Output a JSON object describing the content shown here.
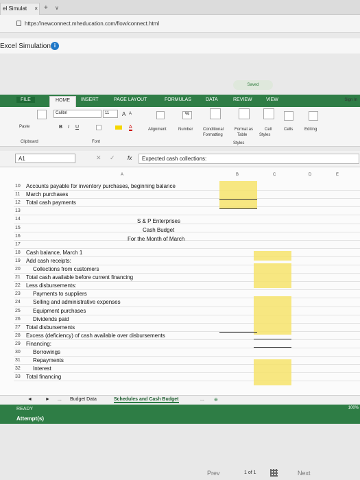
{
  "browser": {
    "tab_title": "el Simulat",
    "tab_close": "×",
    "new_tab": "+",
    "tab_menu": "∨",
    "url": "https://newconnect.mheducation.com/flow/connect.html"
  },
  "app": {
    "title": "Excel Simulation",
    "saved_label": "Saved"
  },
  "ribbon_tabs": [
    "FILE",
    "HOME",
    "INSERT",
    "PAGE LAYOUT",
    "FORMULAS",
    "DATA",
    "REVIEW",
    "VIEW"
  ],
  "sign_in": "Sign In",
  "ribbon": {
    "paste": "Paste",
    "font_name": "Calibri",
    "font_size": "11",
    "grow_font": "A",
    "shrink_font": "A",
    "bold": "B",
    "italic": "I",
    "underline": "U",
    "alignment": "Alignment",
    "number": "Number",
    "percent": "%",
    "conditional": "Conditional",
    "formatting": "Formatting",
    "format_as": "Format as",
    "table": "Table",
    "cell": "Cell",
    "styles_btn": "Styles",
    "cells": "Cells",
    "editing": "Editing",
    "clipboard": "Clipboard",
    "font_group": "Font",
    "styles_group": "Styles"
  },
  "formula_bar": {
    "name_box": "A1",
    "fx": "fx",
    "content": "Expected cash collections:"
  },
  "columns": [
    "A",
    "B",
    "C",
    "D",
    "E"
  ],
  "rows": [
    {
      "n": "10",
      "text": "Accounts payable for inventory purchases, beginning balance"
    },
    {
      "n": "11",
      "text": "March purchases"
    },
    {
      "n": "12",
      "text": "Total cash payments"
    },
    {
      "n": "13",
      "text": ""
    },
    {
      "n": "14",
      "text": ""
    },
    {
      "n": "15",
      "text": ""
    },
    {
      "n": "16",
      "text": ""
    },
    {
      "n": "17",
      "text": ""
    },
    {
      "n": "18",
      "text": "Cash balance, March 1"
    },
    {
      "n": "19",
      "text": "Add cash receipts:"
    },
    {
      "n": "20",
      "text": "Collections from customers"
    },
    {
      "n": "21",
      "text": "Total cash available before current financing"
    },
    {
      "n": "22",
      "text": "Less disbursements:"
    },
    {
      "n": "23",
      "text": "Payments to suppliers"
    },
    {
      "n": "24",
      "text": "Selling and administrative expenses"
    },
    {
      "n": "25",
      "text": "Equipment purchases"
    },
    {
      "n": "26",
      "text": "Dividends paid"
    },
    {
      "n": "27",
      "text": "Total disbursements"
    },
    {
      "n": "28",
      "text": "Excess (deficiency) of cash available over disbursements"
    },
    {
      "n": "29",
      "text": "Financing:"
    },
    {
      "n": "30",
      "text": "Borrowings"
    },
    {
      "n": "31",
      "text": "Repayments"
    },
    {
      "n": "32",
      "text": "Interest"
    },
    {
      "n": "33",
      "text": "Total financing"
    }
  ],
  "header_block": {
    "company": "S & P Enterprises",
    "budget": "Cash Budget",
    "period": "For the Month of March"
  },
  "sheet_tabs": {
    "prev": "◄",
    "next": "►",
    "more": "...",
    "budget_data": "Budget Data",
    "schedules": "Schedules and Cash Budget",
    "more2": "...",
    "add": "⊕"
  },
  "status": {
    "ready": "READY",
    "zoom": "100%",
    "attempts": "Attempt(s)"
  },
  "pager": {
    "prev": "Prev",
    "page": "1 of 1",
    "next": "Next"
  }
}
